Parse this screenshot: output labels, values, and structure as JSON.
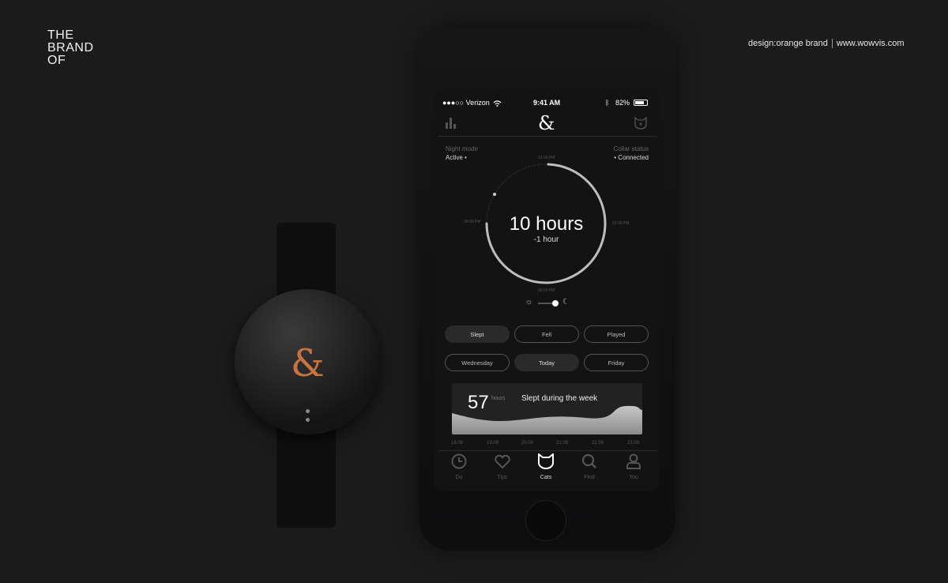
{
  "brand": {
    "lines": [
      "THE",
      "BRAND",
      "OF"
    ]
  },
  "credit": {
    "design": "design:orange brand",
    "site": "www.wowvis.com"
  },
  "watch": {
    "logo": "&",
    "accent": "#c77440"
  },
  "status_bar": {
    "carrier": "●●●○○ Verizon",
    "time": "9:41 AM",
    "battery": "82%",
    "battery_level": 0.82
  },
  "header": {
    "logo": "&",
    "left_icon": "bar-chart-icon",
    "right_icon": "cat-shield-icon"
  },
  "night_mode": {
    "label": "Night mode",
    "value": "Active •"
  },
  "collar_status": {
    "label": "Collar status",
    "value": "• Connected"
  },
  "dial": {
    "main": "10 hours",
    "sub": "-1 hour",
    "ticks": {
      "top": "12:00 PM",
      "right": "03:00 PM",
      "bottom": "06:00 PM",
      "left": "09:00 PM"
    }
  },
  "mode_toggle": {
    "left_icon": "sun-icon",
    "right_icon": "moon-icon",
    "state": "night"
  },
  "activity_buttons": [
    {
      "label": "Slept",
      "active": true
    },
    {
      "label": "Fell",
      "active": false
    },
    {
      "label": "Played",
      "active": false
    }
  ],
  "day_buttons": [
    {
      "label": "Wednesday",
      "active": false
    },
    {
      "label": "Today",
      "active": true
    },
    {
      "label": "Friday",
      "active": false
    }
  ],
  "week_card": {
    "value": "57",
    "unit": "hours",
    "title": "Slept during the week",
    "dates": [
      "18.09",
      "19.09",
      "20.09",
      "21.09",
      "22.09",
      "23.09"
    ]
  },
  "tabs": [
    {
      "label": "Do",
      "icon": "clock-icon"
    },
    {
      "label": "Tips",
      "icon": "heart-icon"
    },
    {
      "label": "Cats",
      "icon": "cat-icon",
      "active": true
    },
    {
      "label": "Find",
      "icon": "search-icon"
    },
    {
      "label": "You",
      "icon": "user-icon"
    }
  ]
}
